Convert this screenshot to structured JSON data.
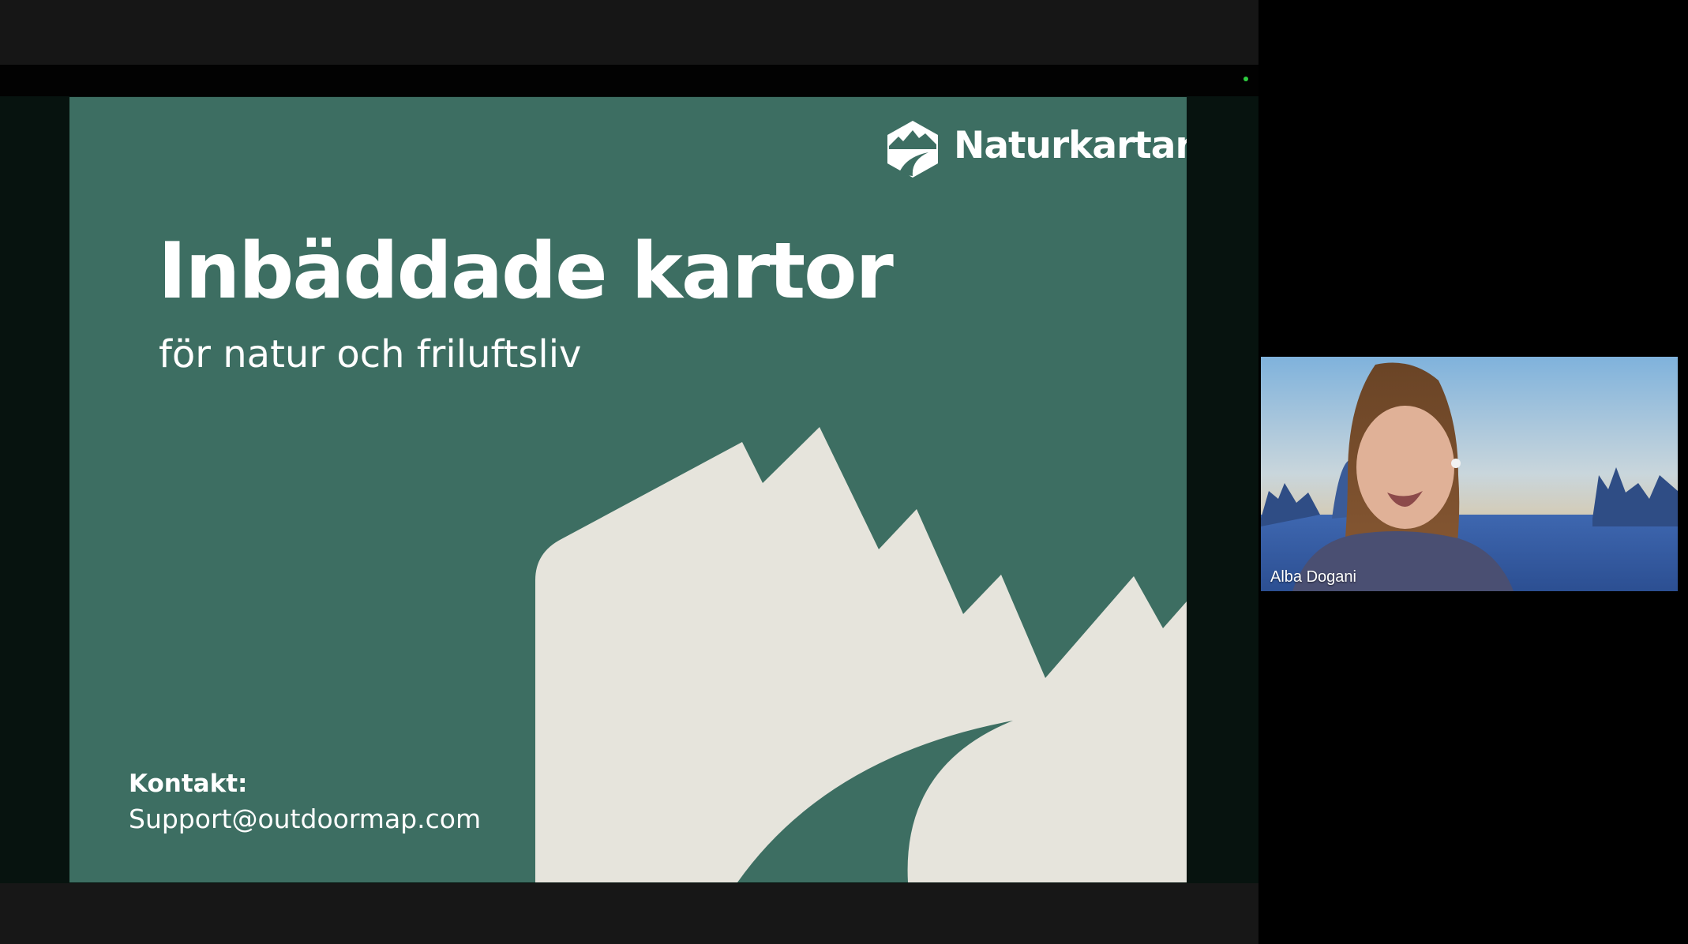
{
  "slide": {
    "logo_text": "Naturkartan",
    "logo_icon": "mountain-hexagon-icon",
    "title": "Inbäddade kartor",
    "subtitle": "för natur och friluftsliv",
    "contact_label": "Kontakt:",
    "contact_email": "Support@outdoormap.com",
    "colors": {
      "background": "#3d6e62",
      "shape": "#e6e4dc",
      "text": "#ffffff"
    }
  },
  "participant": {
    "name": "Alba Dogani"
  },
  "indicators": {
    "status_dot_color": "#2ecc40"
  }
}
